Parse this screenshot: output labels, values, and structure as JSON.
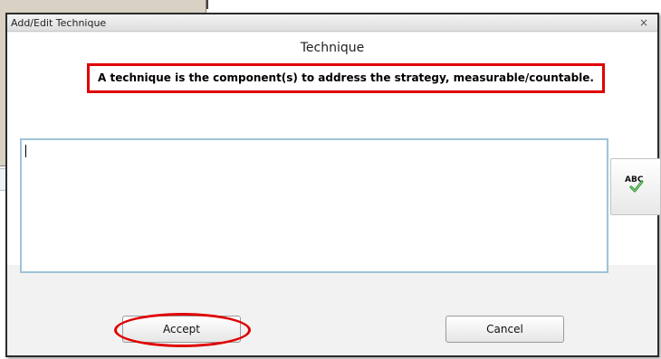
{
  "dialog": {
    "title": "Add/Edit Technique",
    "close_glyph": "×",
    "heading": "Technique",
    "description": "A technique is the component(s) to address the strategy, measurable/countable.",
    "textarea_value": "",
    "spellcheck_icon": "abc-checkmark-icon",
    "spellcheck_text": "ABC",
    "accept_label": "Accept",
    "cancel_label": "Cancel"
  },
  "colors": {
    "highlight": "#e00000",
    "textarea_border": "#9fc3d8",
    "check_green": "#3aa33a"
  }
}
